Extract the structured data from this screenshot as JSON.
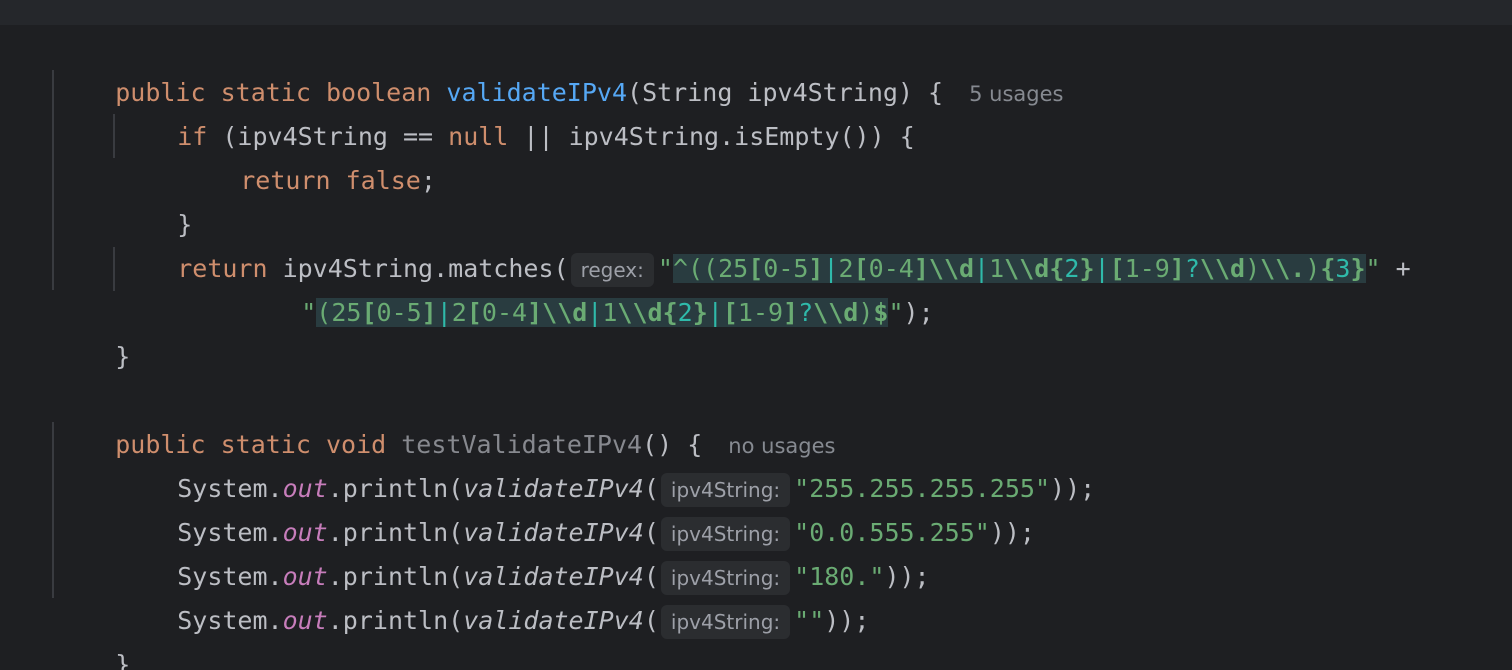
{
  "editor": {
    "lines": [
      {
        "parts": [
          "public",
          " ",
          "static",
          " ",
          "boolean",
          " ",
          "validateIPv4",
          "(String ipv4String) {"
        ],
        "hint": "5 usages"
      },
      {
        "parts": [
          "if",
          " (ipv4String == ",
          "null",
          " || ipv4String.isEmpty()) {"
        ]
      },
      {
        "parts": [
          "return",
          " ",
          "false",
          ";"
        ]
      },
      {
        "text": "}"
      },
      {
        "prefix_kw": "return",
        "prefix": " ipv4String.matches(",
        "inlay": "regex:",
        "q_open": "\"",
        "rx1": [
          "^((",
          "25",
          "[",
          "0-5",
          "]",
          "|",
          "2",
          "[",
          "0-4",
          "]",
          "\\\\d",
          "|",
          "1",
          "\\\\d",
          "{",
          "2",
          "}",
          "|",
          "[",
          "1-9",
          "]",
          "?",
          "\\\\d",
          ")",
          "\\\\.",
          ")",
          "{",
          "3",
          "}"
        ],
        "q_close": "\"",
        "tail": " +"
      },
      {
        "q_open": "\"",
        "rx2": [
          "(",
          "25",
          "[",
          "0-5",
          "]",
          "|",
          "2",
          "[",
          "0-4",
          "]",
          "\\\\d",
          "|",
          "1",
          "\\\\d",
          "{",
          "2",
          "}",
          "|",
          "[",
          "1-9",
          "]",
          "?",
          "\\\\d",
          ")",
          "$"
        ],
        "q_close": "\"",
        "tail": ");"
      },
      {
        "text": "}"
      },
      {
        "parts": [
          "public",
          " ",
          "static",
          " ",
          "void",
          " ",
          "testValidateIPv4",
          "() {"
        ],
        "hint": "no usages"
      },
      {
        "obj": "System.",
        "field": "out",
        "method": ".println(",
        "call": "validateIPv4",
        "paren": "(",
        "inlay": "ipv4String:",
        "arg": "\"255.255.255.255\"",
        "end": "));"
      },
      {
        "obj": "System.",
        "field": "out",
        "method": ".println(",
        "call": "validateIPv4",
        "paren": "(",
        "inlay": "ipv4String:",
        "arg": "\"0.0.555.255\"",
        "end": "));"
      },
      {
        "obj": "System.",
        "field": "out",
        "method": ".println(",
        "call": "validateIPv4",
        "paren": "(",
        "inlay": "ipv4String:",
        "arg": "\"180.\"",
        "end": "));"
      },
      {
        "obj": "System.",
        "field": "out",
        "method": ".println(",
        "call": "validateIPv4",
        "paren": "(",
        "inlay": "ipv4String:",
        "arg": "\"\"",
        "end": "));"
      },
      {
        "text": "}"
      }
    ]
  },
  "colors": {
    "background": "#1e1f22",
    "keyword": "#cf8e6d",
    "method_decl": "#56a8f5",
    "string": "#6aab73",
    "field": "#c77dbb",
    "regex_highlight": "#293c40",
    "hint": "#868a91"
  }
}
